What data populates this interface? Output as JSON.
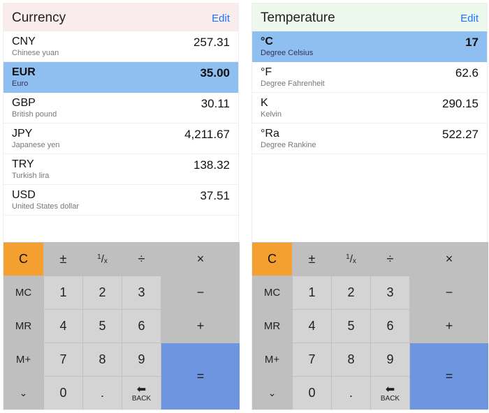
{
  "panels": [
    {
      "header_class": "pink",
      "title": "Currency",
      "edit": "Edit",
      "rows": [
        {
          "code": "CNY",
          "name": "Chinese yuan",
          "value": "257.31",
          "selected": false
        },
        {
          "code": "EUR",
          "name": "Euro",
          "value": "35.00",
          "selected": true
        },
        {
          "code": "GBP",
          "name": "British pound",
          "value": "30.11",
          "selected": false
        },
        {
          "code": "JPY",
          "name": "Japanese yen",
          "value": "4,211.67",
          "selected": false
        },
        {
          "code": "TRY",
          "name": "Turkish lira",
          "value": "138.32",
          "selected": false
        },
        {
          "code": "USD",
          "name": "United States dollar",
          "value": "37.51",
          "selected": false
        }
      ]
    },
    {
      "header_class": "green",
      "title": "Temperature",
      "edit": "Edit",
      "rows": [
        {
          "code": "°C",
          "name": "Degree Celsius",
          "value": "17",
          "selected": true
        },
        {
          "code": "°F",
          "name": "Degree Fahrenheit",
          "value": "62.6",
          "selected": false
        },
        {
          "code": "K",
          "name": "Kelvin",
          "value": "290.15",
          "selected": false
        },
        {
          "code": "°Ra",
          "name": "Degree Rankine",
          "value": "522.27",
          "selected": false
        }
      ]
    }
  ],
  "keypad": {
    "clear": "C",
    "plusminus": "±",
    "reciprocal_num": "1",
    "reciprocal_den": "x",
    "divide": "÷",
    "multiply": "×",
    "mc": "MC",
    "mr": "MR",
    "mplus": "M+",
    "minus": "−",
    "plus": "+",
    "equals": "=",
    "dot": ".",
    "back_arrow": "⬅",
    "back_label": "BACK",
    "chev": "⌄",
    "d1": "1",
    "d2": "2",
    "d3": "3",
    "d4": "4",
    "d5": "5",
    "d6": "6",
    "d7": "7",
    "d8": "8",
    "d9": "9",
    "d0": "0"
  }
}
